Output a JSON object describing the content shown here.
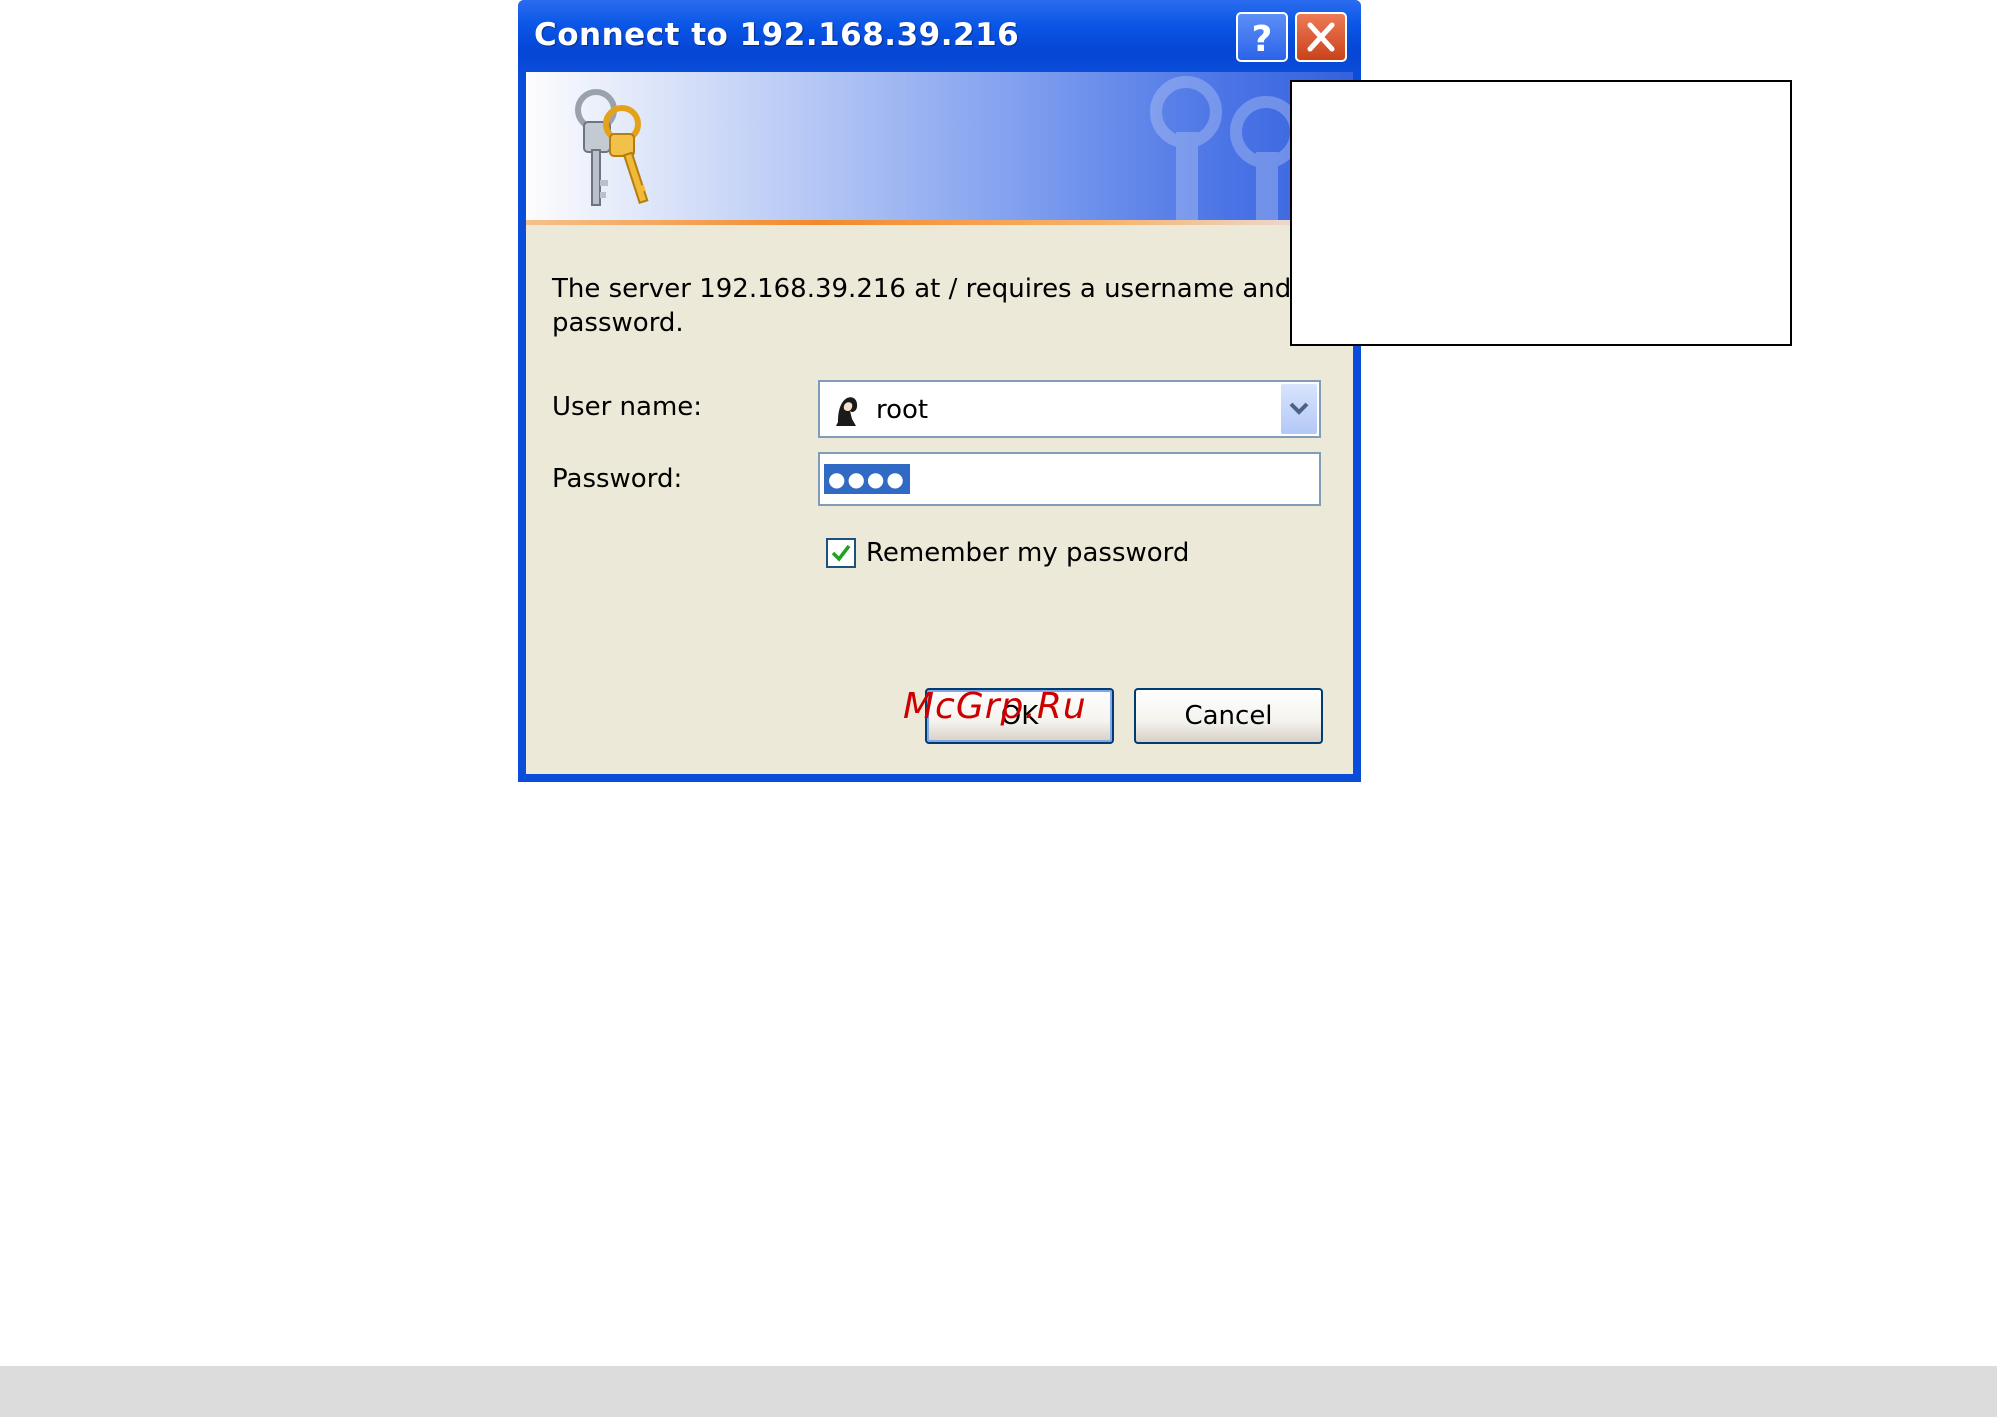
{
  "dialog": {
    "title": "Connect to 192.168.39.216",
    "message": "The server 192.168.39.216 at / requires a username and password.",
    "username_label": "User name:",
    "username_value": "root",
    "password_label": "Password:",
    "password_masked": "●●●●",
    "remember_label": "Remember my password",
    "remember_checked": true,
    "ok_label": "OK",
    "cancel_label": "Cancel"
  },
  "watermark": "McGrp.Ru",
  "icons": {
    "banner": "keys-icon",
    "user": "user-icon",
    "help": "help-icon",
    "close": "close-icon",
    "dropdown": "chevron-down-icon",
    "check": "checkmark-icon"
  },
  "colors": {
    "titlebar": "#0a4dd8",
    "dialog_body": "#ece9d8",
    "close_button": "#c9431a",
    "selection": "#316ac5",
    "watermark": "#cc0000"
  }
}
